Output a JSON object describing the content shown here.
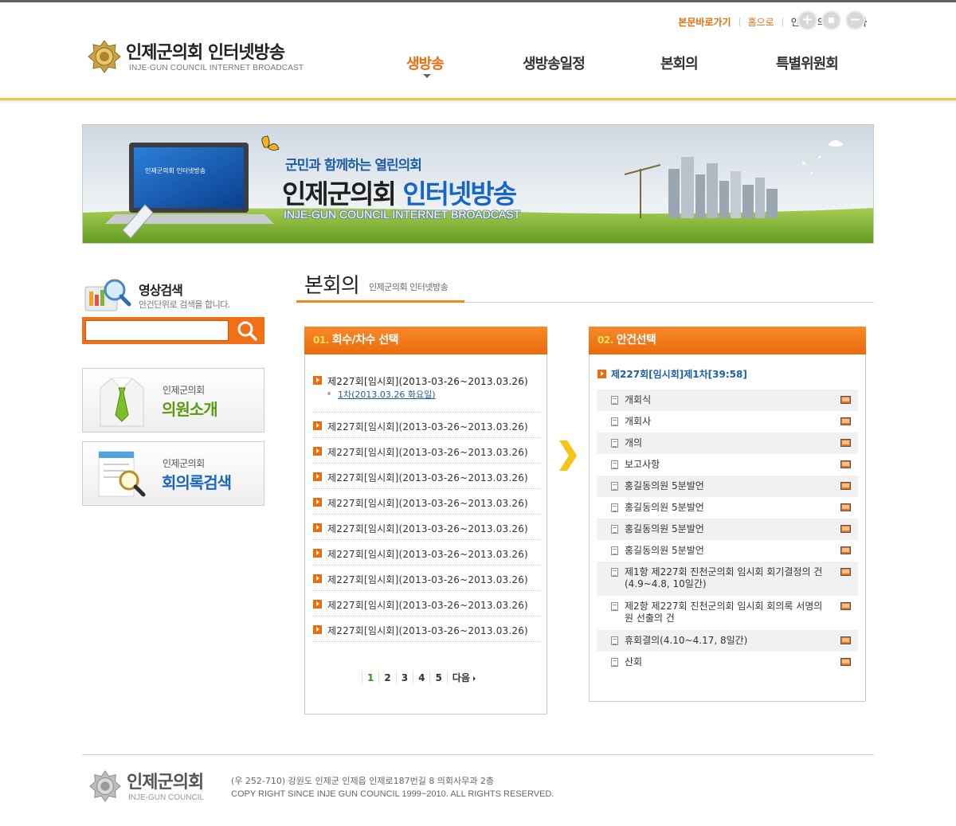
{
  "util": {
    "skip": "본문바로가기",
    "home": "홈으로",
    "council": "인제군의회",
    "font_label": "글자",
    "font_plus": "+",
    "font_minus": "−"
  },
  "logo": {
    "title": "인제군의회 인터넷방송",
    "sub": "INJE-GUN COUNCIL INTERNET BROADCAST"
  },
  "gnb": [
    "생방송",
    "생방송일정",
    "본회의",
    "특별위원회"
  ],
  "banner": {
    "slogan": "군민과 함께하는 열린의회",
    "title_a": "인제군의회",
    "title_b": "인터넷방송",
    "eng": "INJE-GUN COUNCIL INTERNET BROADCAST",
    "screen_text": "인제군의회 인터넷방송"
  },
  "video_search": {
    "title": "영상검색",
    "desc": "안건단위로 검색을 합니다.",
    "placeholder": ""
  },
  "quick": [
    {
      "small": "인제군의회",
      "large": "의원소개"
    },
    {
      "small": "인제군의회",
      "large": "회의록검색"
    }
  ],
  "page": {
    "title": "본회의",
    "sub": "인제군의회 인터넷방송"
  },
  "panel1": {
    "num": "01.",
    "title": "회수/차수 선택",
    "sessions": [
      "제227회[임시회](2013-03-26~2013.03.26)",
      "제227회[임시회](2013-03-26~2013.03.26)",
      "제227회[임시회](2013-03-26~2013.03.26)",
      "제227회[임시회](2013-03-26~2013.03.26)",
      "제227회[임시회](2013-03-26~2013.03.26)",
      "제227회[임시회](2013-03-26~2013.03.26)",
      "제227회[임시회](2013-03-26~2013.03.26)",
      "제227회[임시회](2013-03-26~2013.03.26)",
      "제227회[임시회](2013-03-26~2013.03.26)",
      "제227회[임시회](2013-03-26~2013.03.26)"
    ],
    "sub_item": "1차(2013.03.26 화요일)",
    "pager": [
      "1",
      "2",
      "3",
      "4",
      "5",
      "다음"
    ],
    "current_page": "1"
  },
  "panel2": {
    "num": "02.",
    "title": "안건선택",
    "head": "제227회[임시회]제1차[39:58]",
    "items": [
      "개회식",
      "개회사",
      "개의",
      "보고사항",
      "홍길동의원 5분발언",
      "홍길동의원 5분발언",
      "홍길동의원 5분발언",
      "홍길동의원 5분발언",
      "제1항 제227회 진천군의회 임시회 회기결정의 건(4.9~4.8, 10일간)",
      "제2항 제227회 진천군의회 임시회 회의록 서명의원 선출의 건",
      "휴회결의(4.10~4.17, 8일간)",
      "산회"
    ]
  },
  "footer": {
    "name": "인제군의회",
    "eng": "INJE-GUN COUNCIL",
    "address": "(우 252-710) 강원도 인제군 인제읍 인제로187번길 8 의회사무과 2층",
    "copyright": "COPY RIGHT SINCE INJE GUN COUNCIL 1999~2010. ALL RIGHTS RESERVED."
  },
  "colors": {
    "accent": "#ee6a0a",
    "accent_yellow": "#f3c43f",
    "link_blue": "#1d5ea8",
    "green": "#5a9a13"
  },
  "icons": [
    "plus-icon",
    "stop-icon",
    "minus-icon",
    "search-icon",
    "document-icon",
    "monitor-icon",
    "arrow-right-icon"
  ]
}
